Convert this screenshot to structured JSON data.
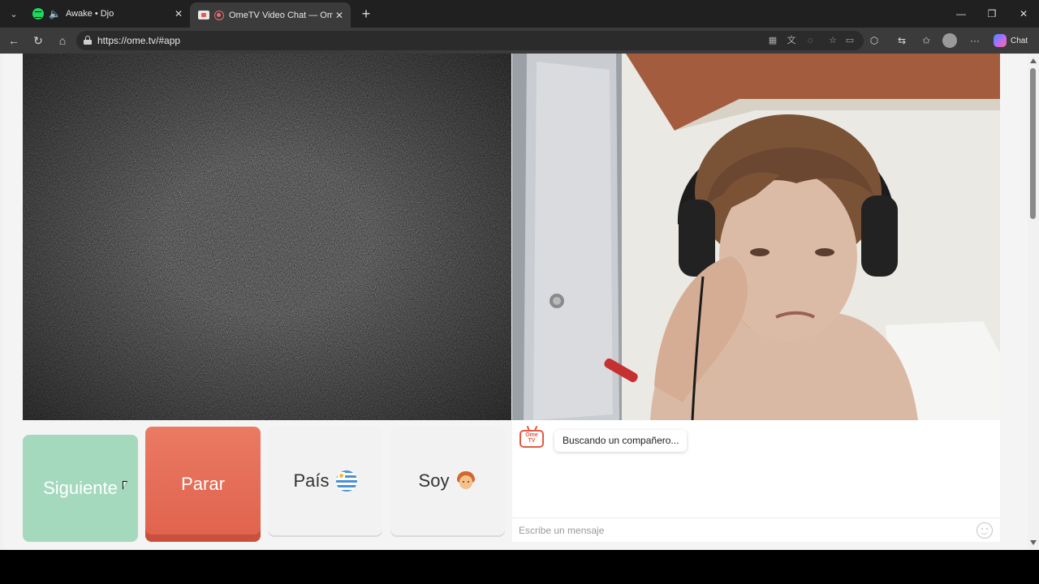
{
  "browser": {
    "tabs": [
      {
        "title": "Awake • Djo",
        "favicon": "spotify-icon",
        "audio": true
      },
      {
        "title": "OmeTV Video Chat — Omegle",
        "favicon": "ometv-icon",
        "recording": true,
        "active": true
      }
    ],
    "url": "https://ome.tv/#app",
    "chat_label": "Chat"
  },
  "controls": {
    "next_label": "Siguiente",
    "stop_label": "Parar",
    "country_label": "País",
    "gender_label": "Soy"
  },
  "chat": {
    "logo_text": "Ome TV",
    "status_message": "Buscando un compañero...",
    "input_placeholder": "Escribe un mensaje"
  },
  "colors": {
    "next_button": "#a4d9bd",
    "stop_button": "#e36a53",
    "accent": "#e35a45"
  }
}
